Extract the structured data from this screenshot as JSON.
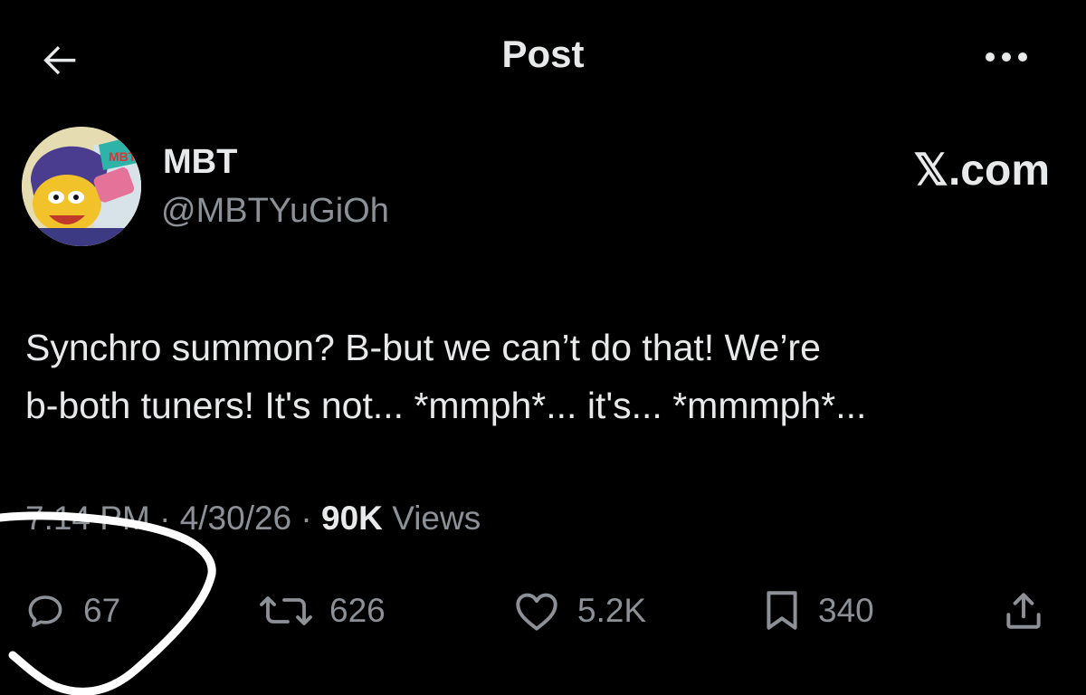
{
  "header": {
    "title": "Post",
    "back_icon": "arrow-left-icon",
    "more_icon": "more-horizontal-icon"
  },
  "author": {
    "name": "MBT",
    "handle": "@MBTYuGiOh",
    "avatar": "cartoon-character-avatar"
  },
  "source_label": "𝕏.com",
  "post": {
    "text_line1": "Synchro summon? B-but we can’t do that! We’re",
    "text_line2": "b-both tuners! It's not... *mmph*... it's... *mmmph*..."
  },
  "meta": {
    "time": "7:14 PM",
    "sep1": " · ",
    "date": "4/30/26",
    "sep2": " · ",
    "views_count": "90K",
    "views_label": " Views"
  },
  "actions": {
    "reply": {
      "icon": "reply-icon",
      "count": "67"
    },
    "repost": {
      "icon": "repost-icon",
      "count": "626"
    },
    "like": {
      "icon": "heart-icon",
      "count": "5.2K"
    },
    "bookmark": {
      "icon": "bookmark-icon",
      "count": "340"
    },
    "share": {
      "icon": "share-icon"
    }
  },
  "colors": {
    "background": "#000000",
    "text_primary": "#e7e9ea",
    "text_secondary": "#8b9196",
    "annotation": "#ffffff"
  }
}
